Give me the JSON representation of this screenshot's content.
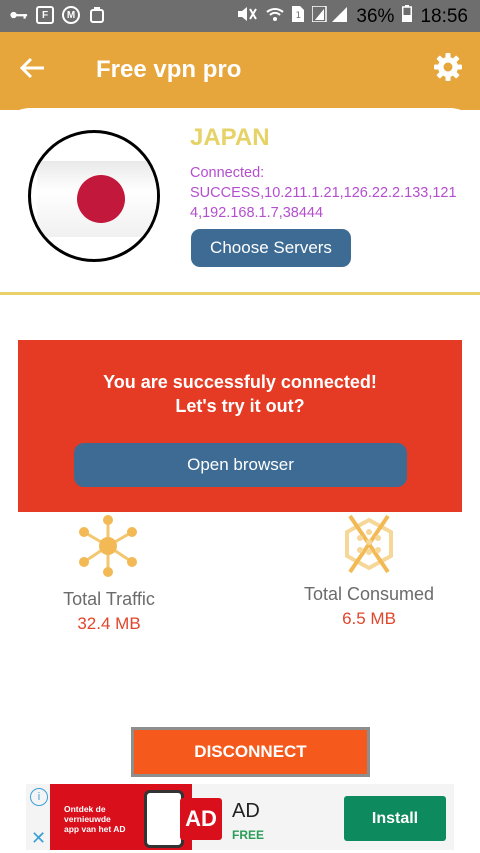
{
  "status_bar": {
    "battery": "36%",
    "time": "18:56",
    "left_icons": [
      "key-icon",
      "flipboard-icon",
      "media-icon",
      "clean-icon"
    ],
    "right_icons": [
      "mute-icon",
      "wifi-icon",
      "sim-icon",
      "signal-icon",
      "battery-icon"
    ]
  },
  "app_bar": {
    "title": "Free vpn pro",
    "back_icon": "arrow-left-icon",
    "settings_icon": "gear-icon",
    "color": "#e6a63c"
  },
  "server": {
    "country": "JAPAN",
    "connection_text": "Connected: SUCCESS,10.211.1.21,126.22.2.133,1214,192.168.1.7,38444",
    "choose_servers_label": "Choose Servers"
  },
  "banner": {
    "line1": "You are successfuly connected!",
    "line2": "Let's try it out?",
    "open_browser_label": "Open browser",
    "color": "#e53b25"
  },
  "stats": {
    "traffic_label": "Total Traffic",
    "traffic_value": "32.4 MB",
    "consumed_label": "Total Consumed",
    "consumed_value": "6.5 MB"
  },
  "disconnect_label": "DISCONNECT",
  "ad": {
    "image_text": "Ontdek de vernieuwde app van het AD",
    "logo_text": "AD",
    "name": "AD",
    "price": "FREE",
    "install_label": "Install"
  }
}
